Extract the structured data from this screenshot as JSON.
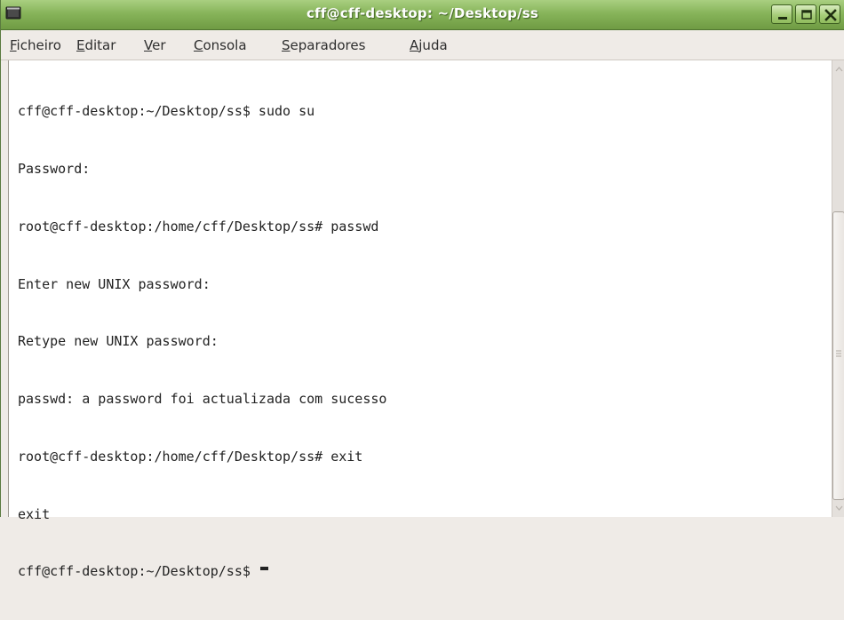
{
  "window": {
    "title": "cff@cff-desktop: ~/Desktop/ss",
    "controls": {
      "minimize_icon": "minimize-icon",
      "maximize_icon": "maximize-icon",
      "close_icon": "close-icon"
    },
    "accent_color": "#87b45a"
  },
  "menubar": {
    "items": [
      {
        "mnemonic": "F",
        "rest": "icheiro"
      },
      {
        "mnemonic": "E",
        "rest": "ditar"
      },
      {
        "mnemonic": "V",
        "rest": "er"
      },
      {
        "mnemonic": "C",
        "rest": "onsola"
      },
      {
        "mnemonic": "S",
        "rest": "eparadores"
      },
      {
        "mnemonic": "A",
        "rest": "juda"
      }
    ]
  },
  "terminal": {
    "lines": [
      "cff@cff-desktop:~/Desktop/ss$ sudo su",
      "Password:",
      "root@cff-desktop:/home/cff/Desktop/ss# passwd",
      "Enter new UNIX password:",
      "Retype new UNIX password:",
      "passwd: a password foi actualizada com sucesso",
      "root@cff-desktop:/home/cff/Desktop/ss# exit",
      "exit",
      "cff@cff-desktop:~/Desktop/ss$ "
    ],
    "background": "#ffffff",
    "foreground": "#222222"
  }
}
